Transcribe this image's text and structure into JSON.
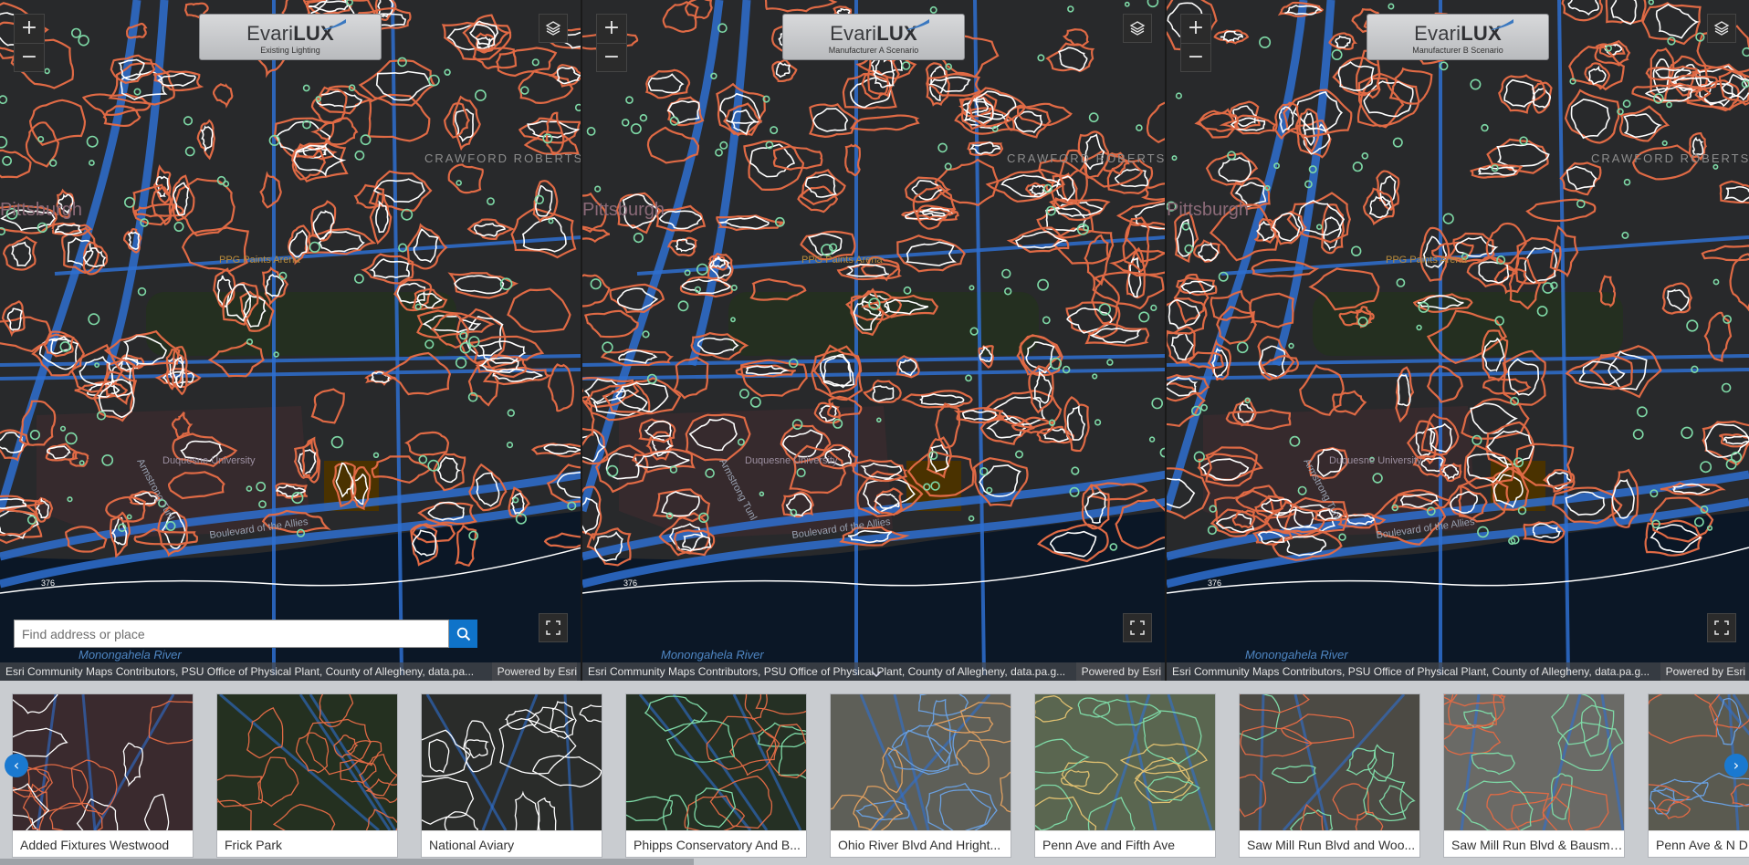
{
  "brand": {
    "name_light": "Evari",
    "name_bold": "LUX"
  },
  "maps": [
    {
      "scenario": "Existing Lighting",
      "attribution": "Esri Community Maps Contributors, PSU Office of Physical Plant, County of Allegheny, data.pa...",
      "powered": "Powered by Esri"
    },
    {
      "scenario": "Manufacturer A Scenario",
      "attribution": "Esri Community Maps Contributors, PSU Office of Physical Plant, County of Allegheny, data.pa.g...",
      "powered": "Powered by Esri"
    },
    {
      "scenario": "Manufacturer B Scenario",
      "attribution": "Esri Community Maps Contributors, PSU Office of Physical Plant, County of Allegheny, data.pa.g...",
      "powered": "Powered by Esri"
    }
  ],
  "map_labels": {
    "city": "Pittsburgh",
    "arena": "PPG Paints Arena",
    "university": "Duquesne University",
    "tunnel": "Armstrong Tunl",
    "boulevard": "Boulevard of the Allies",
    "river": "Monongahela River",
    "district": "CRAWFORD ROBERTS",
    "route": "376"
  },
  "controls": {
    "zoom_in": "+",
    "zoom_out": "−"
  },
  "search": {
    "placeholder": "Find address or place"
  },
  "carousel": {
    "items": [
      {
        "label": "Added Fixtures Westwood"
      },
      {
        "label": "Frick Park"
      },
      {
        "label": "National Aviary"
      },
      {
        "label": "Phipps Conservatory And B..."
      },
      {
        "label": "Ohio River Blvd And Hright..."
      },
      {
        "label": "Penn Ave and Fifth Ave"
      },
      {
        "label": "Saw Mill Run Blvd and Woo..."
      },
      {
        "label": "Saw Mill Run Blvd & Bausma..."
      },
      {
        "label": "Penn Ave & N D..."
      }
    ],
    "prev": "‹",
    "next": "›"
  },
  "colors": {
    "contour_red": "#e06a45",
    "contour_white": "#ffffff",
    "contour_green": "#7ed9a6",
    "road_blue": "#2e6fd0",
    "accent": "#1a79d0"
  }
}
